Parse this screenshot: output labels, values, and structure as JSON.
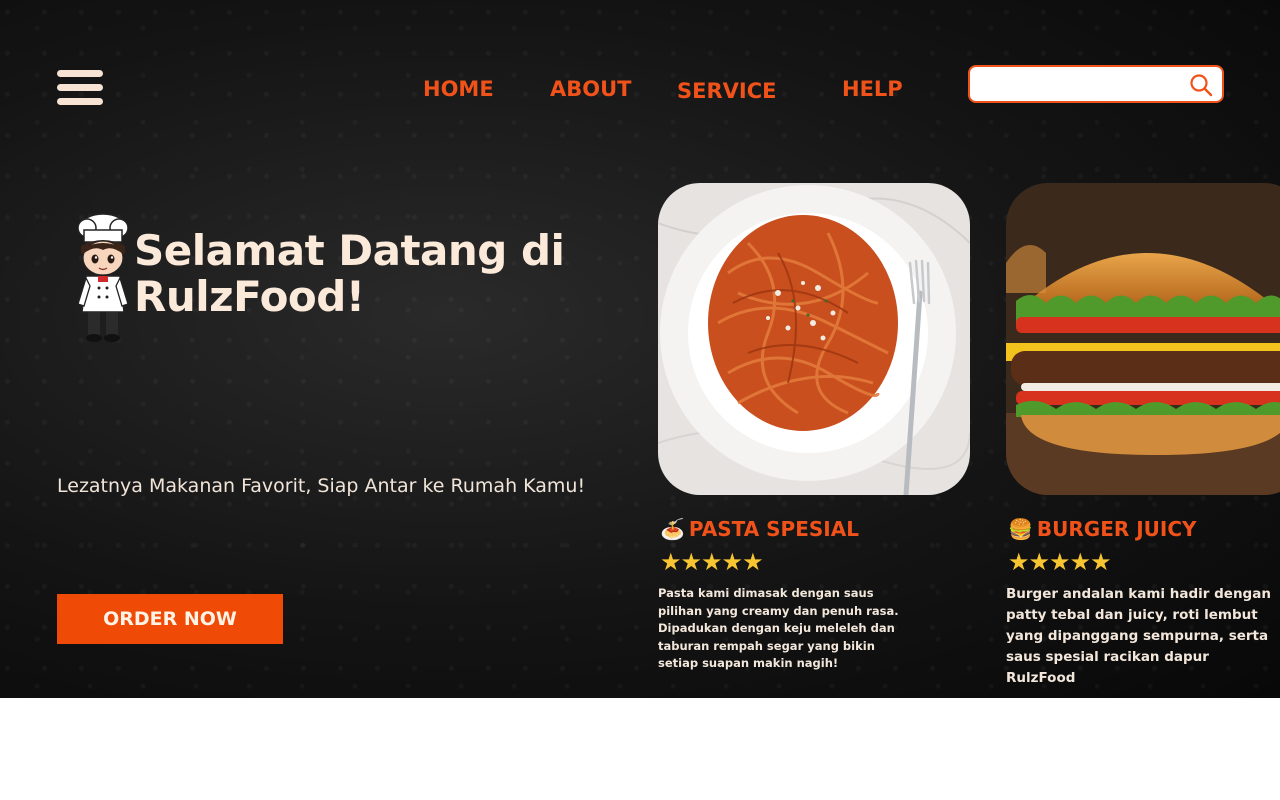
{
  "nav": {
    "menu_icon": "hamburger-menu-icon",
    "items": [
      "HOME",
      "ABOUT",
      "SERVICE",
      "HELP"
    ]
  },
  "search": {
    "value": "",
    "placeholder": "",
    "icon": "search-icon"
  },
  "hero": {
    "title": "Selamat Datang di RulzFood!",
    "tagline": "Lezatnya Makanan Favorit, Siap Antar ke Rumah Kamu!",
    "cta_label": "ORDER NOW"
  },
  "cards": [
    {
      "emoji": "🍝",
      "title": "PASTA SPESIAL",
      "stars": "★★★★★",
      "rating": 5,
      "description": "Pasta kami dimasak dengan saus pilihan yang creamy dan penuh rasa. Dipadukan dengan keju meleleh dan taburan rempah segar yang bikin setiap suapan makin nagih!"
    },
    {
      "emoji": "🍔",
      "title": "BURGER JUICY",
      "stars": "★★★★★",
      "rating": 5,
      "description": "Burger andalan kami hadir dengan patty tebal dan juicy, roti lembut yang dipanggang sempurna, serta saus spesial racikan dapur RulzFood"
    }
  ],
  "colors": {
    "accent": "#f0521a",
    "cta": "#f04a07",
    "title_text": "#fbe9da",
    "stars": "#f7c531",
    "background": "#141414"
  }
}
